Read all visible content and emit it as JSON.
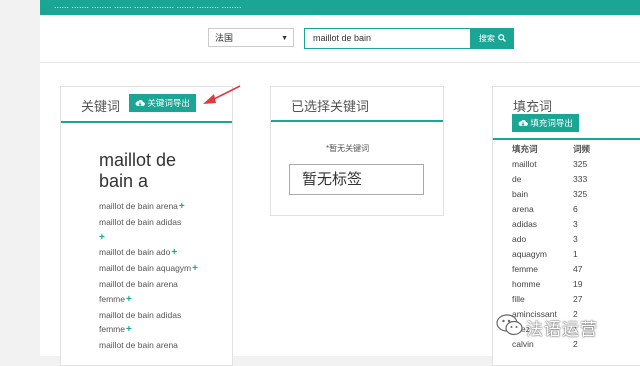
{
  "header": {
    "banner_text": "...... ....... ........ ....... ...... ......... ....... ......... ........"
  },
  "search": {
    "country": "法国",
    "query": "maillot de bain",
    "button_label": "搜索"
  },
  "keywords_panel": {
    "title": "关键词",
    "export_label": "关键词导出",
    "main_keyword": "maillot de bain a",
    "items": [
      "maillot de bain arena",
      "maillot de bain adidas",
      "maillot de bain ado",
      "maillot de bain aquagym",
      "maillot de bain arena femme",
      "maillot de bain adidas femme",
      "maillot de bain arena"
    ]
  },
  "selected_panel": {
    "title": "已选择关键词",
    "note": "*暂无关键词",
    "empty_tag": "暂无标签"
  },
  "filler_panel": {
    "title": "填充词",
    "export_label": "填充词导出",
    "col_word": "填充词",
    "col_freq": "词频",
    "rows": [
      {
        "word": "maillot",
        "freq": "325"
      },
      {
        "word": "de",
        "freq": "333"
      },
      {
        "word": "bain",
        "freq": "325"
      },
      {
        "word": "arena",
        "freq": "6"
      },
      {
        "word": "adidas",
        "freq": "3"
      },
      {
        "word": "ado",
        "freq": "3"
      },
      {
        "word": "aquagym",
        "freq": "1"
      },
      {
        "word": "femme",
        "freq": "47"
      },
      {
        "word": "homme",
        "freq": "19"
      },
      {
        "word": "fille",
        "freq": "27"
      },
      {
        "word": "amincissant",
        "freq": "2"
      },
      {
        "word": "chez",
        "freq": "1"
      },
      {
        "word": "calvin",
        "freq": "2"
      }
    ]
  },
  "watermark": {
    "text": "法语运营"
  },
  "colors": {
    "accent": "#1aa594",
    "arrow": "#e0393e"
  }
}
